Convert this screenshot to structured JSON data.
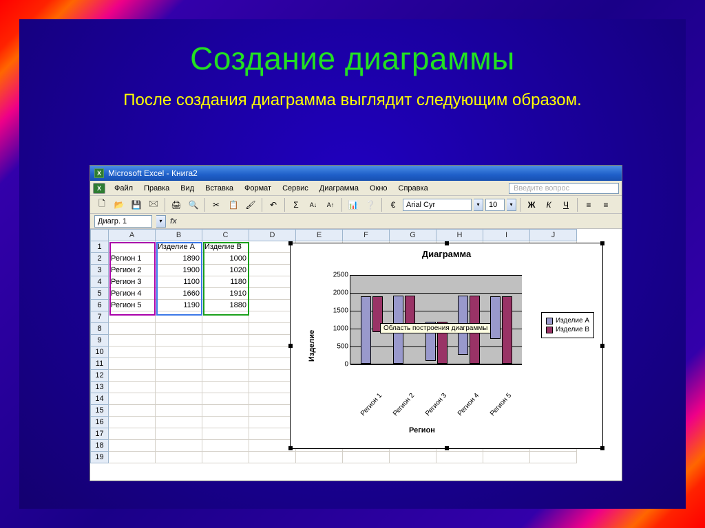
{
  "slide": {
    "title": "Создание диаграммы",
    "subtitle": "После создания диаграмма выглядит следующим образом."
  },
  "window": {
    "title": "Microsoft Excel - Книга2",
    "question_prompt": "Введите вопрос"
  },
  "menu": {
    "file": "Файл",
    "edit": "Правка",
    "view": "Вид",
    "insert": "Вставка",
    "format": "Формат",
    "tools": "Сервис",
    "chart": "Диаграмма",
    "window": "Окно",
    "help": "Справка"
  },
  "toolbar": {
    "font_name": "Arial Cyr",
    "font_size": "10",
    "bold": "Ж",
    "italic": "К",
    "underline": "Ч"
  },
  "formula_bar": {
    "name_box": "Диагр. 1",
    "fx": "fx"
  },
  "columns": [
    "A",
    "B",
    "C",
    "D",
    "E",
    "F",
    "G",
    "H",
    "I",
    "J"
  ],
  "row_headers": [
    "1",
    "2",
    "3",
    "4",
    "5",
    "6",
    "7",
    "8",
    "9",
    "10",
    "11",
    "12",
    "13",
    "14",
    "15",
    "16",
    "17",
    "18",
    "19"
  ],
  "table": {
    "header_row": [
      "",
      "Изделие A",
      "Изделие B"
    ],
    "rows": [
      [
        "Регион 1",
        "1890",
        "1000"
      ],
      [
        "Регион 2",
        "1900",
        "1020"
      ],
      [
        "Регион 3",
        "1100",
        "1180"
      ],
      [
        "Регион 4",
        "1660",
        "1910"
      ],
      [
        "Регион 5",
        "1190",
        "1880"
      ]
    ]
  },
  "chart": {
    "title": "Диаграмма",
    "ylabel": "Изделие",
    "xlabel": "Регион",
    "yticks": [
      "0",
      "500",
      "1000",
      "1500",
      "2000",
      "2500"
    ],
    "tooltip": "Область построения диаграммы",
    "legend": [
      "Изделие A",
      "Изделие B"
    ]
  },
  "chart_data": {
    "type": "bar",
    "title": "Диаграмма",
    "xlabel": "Регион",
    "ylabel": "Изделие",
    "categories": [
      "Регион 1",
      "Регион 2",
      "Регион 3",
      "Регион 4",
      "Регион 5"
    ],
    "series": [
      {
        "name": "Изделие A",
        "values": [
          1890,
          1900,
          1100,
          1660,
          1190
        ],
        "color": "#9999cc"
      },
      {
        "name": "Изделие B",
        "values": [
          1000,
          1020,
          1180,
          1910,
          1880
        ],
        "color": "#993366"
      }
    ],
    "ylim": [
      0,
      2500
    ],
    "ytick_interval": 500
  }
}
